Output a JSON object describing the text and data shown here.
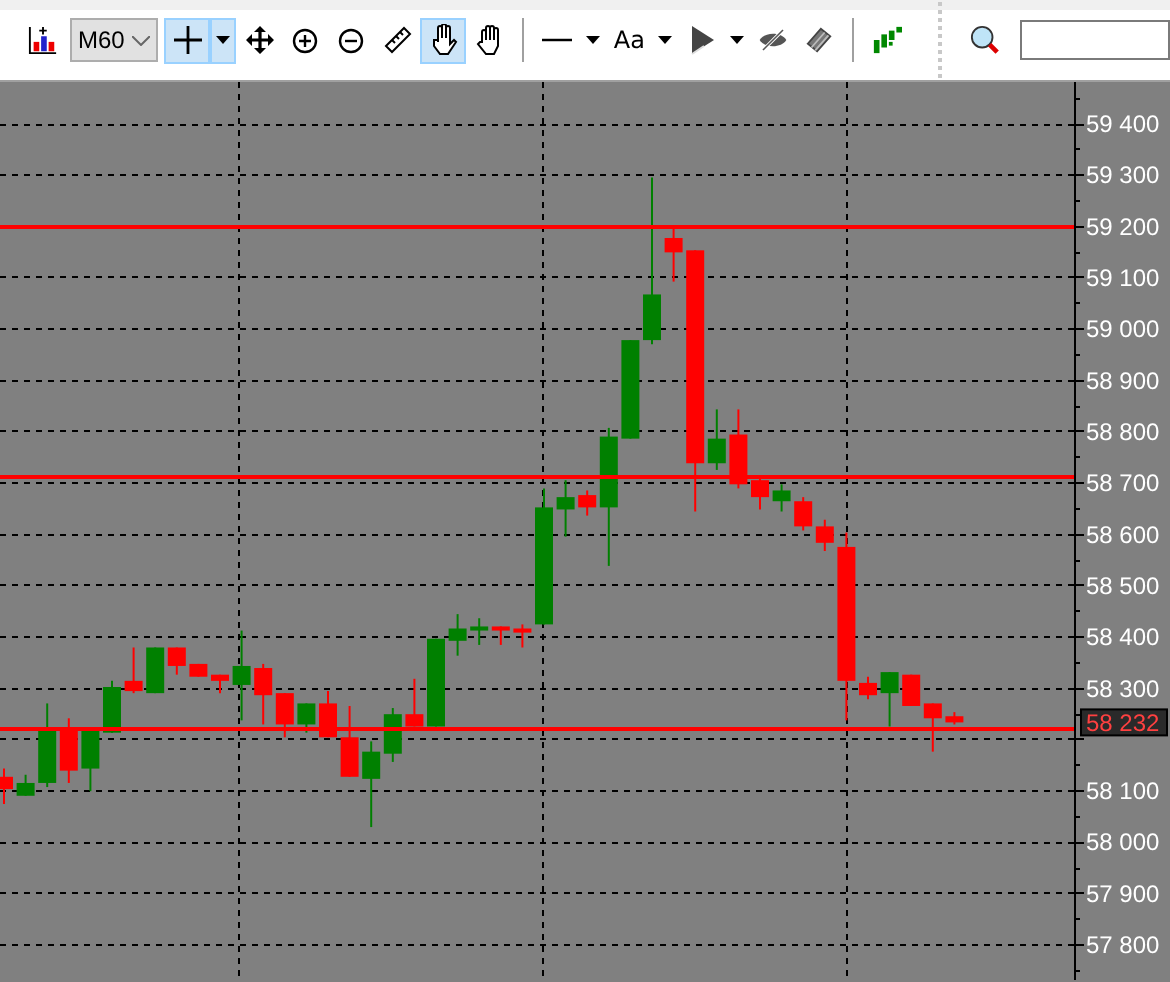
{
  "toolbar": {
    "items": [
      {
        "kind": "chart",
        "selected": false
      },
      {
        "kind": "timeframe",
        "text": "M60"
      },
      {
        "kind": "crosshair",
        "selected": true
      },
      {
        "kind": "move",
        "selected": false
      },
      {
        "kind": "zoom-in",
        "selected": false
      },
      {
        "kind": "zoom-out",
        "selected": false
      },
      {
        "kind": "ruler",
        "selected": false
      },
      {
        "kind": "finger",
        "selected": true
      },
      {
        "kind": "hand",
        "selected": false
      },
      {
        "kind": "separator"
      },
      {
        "kind": "line",
        "selected": false
      },
      {
        "kind": "text",
        "text": "Aa",
        "selected": false
      },
      {
        "kind": "pointer",
        "selected": false
      },
      {
        "kind": "hide",
        "selected": false
      },
      {
        "kind": "eraser",
        "selected": false
      },
      {
        "kind": "separator"
      },
      {
        "kind": "bars",
        "selected": false
      },
      {
        "kind": "dots"
      },
      {
        "kind": "search",
        "selected": false
      },
      {
        "kind": "search-field"
      }
    ]
  },
  "chart_data": {
    "type": "candlestick",
    "ylim": [
      57730,
      59480
    ],
    "yticks": [
      {
        "value": 59400,
        "label": "59 400"
      },
      {
        "value": 59300,
        "label": "59 300"
      },
      {
        "value": 59200,
        "label": "59 200"
      },
      {
        "value": 59100,
        "label": "59 100"
      },
      {
        "value": 59000,
        "label": "59 000"
      },
      {
        "value": 58900,
        "label": "58 900"
      },
      {
        "value": 58800,
        "label": "58 800"
      },
      {
        "value": 58700,
        "label": "58 700"
      },
      {
        "value": 58600,
        "label": "58 600"
      },
      {
        "value": 58500,
        "label": "58 500"
      },
      {
        "value": 58400,
        "label": "58 400"
      },
      {
        "value": 58300,
        "label": "58 300"
      },
      {
        "value": 58100,
        "label": "58 100"
      },
      {
        "value": 58000,
        "label": "58 000"
      },
      {
        "value": 57900,
        "label": "57 900"
      },
      {
        "value": 57800,
        "label": "57 800"
      }
    ],
    "grid": true,
    "ohlc": [
      [
        58126,
        58142,
        58073,
        58102
      ],
      [
        58089,
        58130,
        58089,
        58114
      ],
      [
        58114,
        58269,
        58106,
        58216
      ],
      [
        58220,
        58240,
        58114,
        58138
      ],
      [
        58142,
        58216,
        58098,
        58216
      ],
      [
        58212,
        58313,
        58212,
        58301
      ],
      [
        58313,
        58378,
        58289,
        58293
      ],
      [
        58289,
        58378,
        58289,
        58378
      ],
      [
        58378,
        58378,
        58325,
        58342
      ],
      [
        58346,
        58346,
        58321,
        58321
      ],
      [
        58325,
        58325,
        58289,
        58313
      ],
      [
        58305,
        58411,
        58236,
        58342
      ],
      [
        58338,
        58346,
        58228,
        58285
      ],
      [
        58289,
        58289,
        58203,
        58228
      ],
      [
        58228,
        58269,
        58212,
        58269
      ],
      [
        58269,
        58293,
        58203,
        58203
      ],
      [
        58203,
        58264,
        58126,
        58126
      ],
      [
        58122,
        58195,
        58028,
        58175
      ],
      [
        58171,
        58260,
        58155,
        58248
      ],
      [
        58248,
        58317,
        58224,
        58224
      ],
      [
        58224,
        58395,
        58224,
        58395
      ],
      [
        58391,
        58443,
        58362,
        58415
      ],
      [
        58411,
        58435,
        58383,
        58419
      ],
      [
        58419,
        58419,
        58383,
        58411
      ],
      [
        58415,
        58423,
        58378,
        58407
      ],
      [
        58423,
        58688,
        58423,
        58651
      ],
      [
        58647,
        58704,
        58594,
        58671
      ],
      [
        58675,
        58684,
        58635,
        58651
      ],
      [
        58651,
        58806,
        58537,
        58789
      ],
      [
        58785,
        58977,
        58785,
        58977
      ],
      [
        58977,
        59294,
        58969,
        59066
      ],
      [
        59176,
        59200,
        59091,
        59148
      ],
      [
        59152,
        59152,
        58643,
        58737
      ],
      [
        58737,
        58842,
        58724,
        58785
      ],
      [
        58793,
        58842,
        58688,
        58696
      ],
      [
        58704,
        58712,
        58647,
        58671
      ],
      [
        58663,
        58696,
        58643,
        58684
      ],
      [
        58663,
        58671,
        58606,
        58614
      ],
      [
        58614,
        58627,
        58566,
        58582
      ],
      [
        58574,
        58602,
        58236,
        58313
      ],
      [
        58309,
        58321,
        58277,
        58285
      ],
      [
        58289,
        58330,
        58224,
        58330
      ],
      [
        58325,
        58325,
        58264,
        58264
      ],
      [
        58269,
        58269,
        58175,
        58240
      ],
      [
        58244,
        58252,
        58228,
        58232
      ]
    ],
    "ref_lines": [
      {
        "axis": "y",
        "value": 59200,
        "color": "#ff0000"
      },
      {
        "axis": "y",
        "value": 58712,
        "color": "#ff0000"
      },
      {
        "axis": "y",
        "value": 58220,
        "color": "#ff0000"
      }
    ]
  },
  "price_tag": "58 232"
}
